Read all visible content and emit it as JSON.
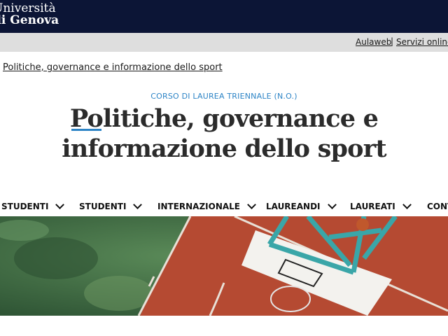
{
  "header": {
    "logo_line1": "Università",
    "logo_line2": "di Genova"
  },
  "utility_links": {
    "aulaweb": "Aulaweb",
    "separator": "|",
    "servizi": "Servizi online"
  },
  "breadcrumb": "Politiche, governance e informazione dello sport",
  "course": {
    "kicker": "CORSO DI LAUREA TRIENNALE (N.O.)",
    "title_first": "Po",
    "title_rest1": "litiche, governance e",
    "title_line2": "informazione dello sport"
  },
  "nav": [
    {
      "label": "STUDENTI"
    },
    {
      "label": "STUDENTI"
    },
    {
      "label": "INTERNAZIONALE"
    },
    {
      "label": "LAUREANDI"
    },
    {
      "label": "LAUREATI"
    },
    {
      "label": "CONT"
    }
  ],
  "hero": {
    "image": "basketball court aerial photo",
    "colors": {
      "grass": "#3f6b44",
      "court": "#b54a32",
      "hoop_frame": "#3aa6a8",
      "backboard": "#f2f2f2"
    }
  }
}
